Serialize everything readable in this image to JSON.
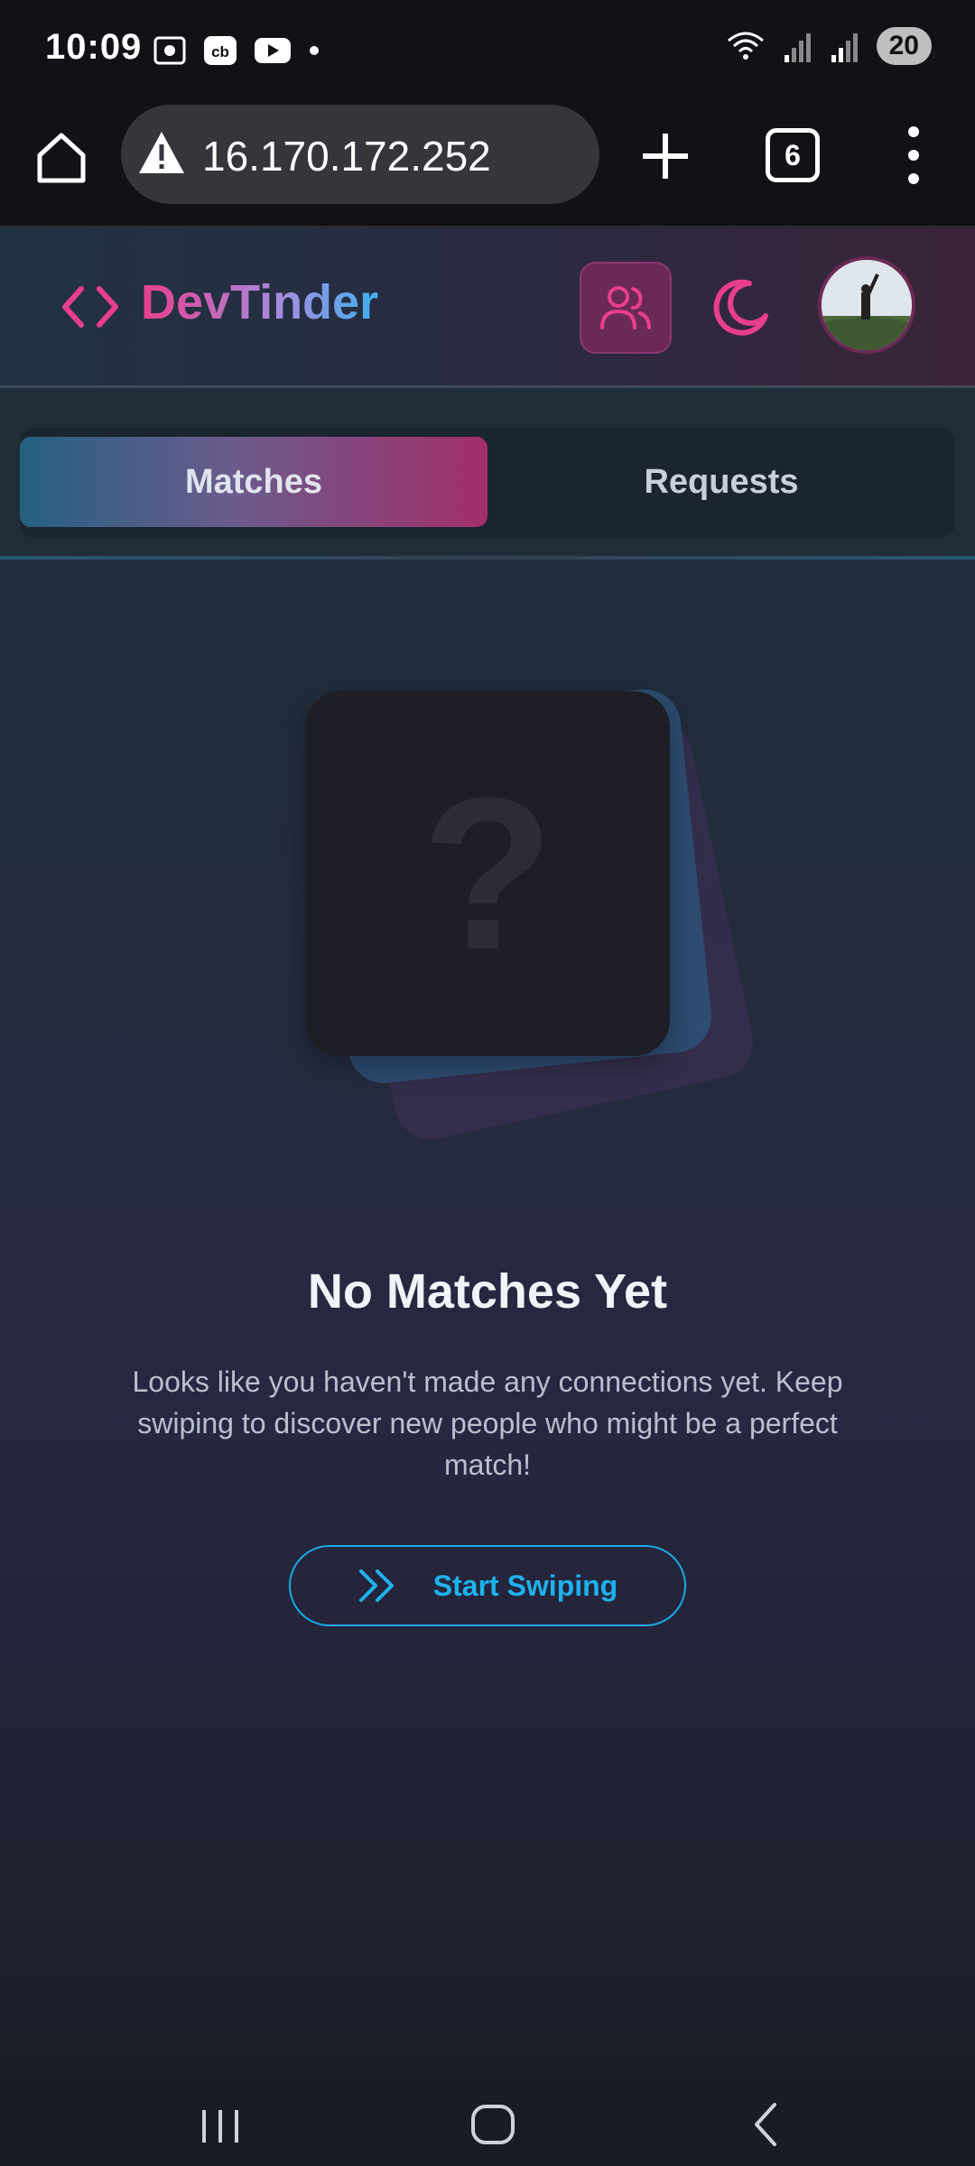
{
  "status_bar": {
    "time": "10:09",
    "battery": "20",
    "left_icons": [
      "screenshot-icon",
      "cb-icon",
      "youtube-icon",
      "dot-icon"
    ],
    "right_icons": [
      "wifi-icon",
      "signal-icon",
      "signal-icon"
    ]
  },
  "browser": {
    "url": "16.170.172.252",
    "tab_count": "6"
  },
  "header": {
    "app_name": "DevTinder",
    "accent_pink": "#e83e8c",
    "accent_blue": "#3fb0ee"
  },
  "tabs": [
    {
      "label": "Matches",
      "active": true
    },
    {
      "label": "Requests",
      "active": false
    }
  ],
  "empty_state": {
    "placeholder_glyph": "?",
    "title": "No Matches Yet",
    "description": "Looks like you haven't made any connections yet. Keep swiping to discover new people who might be a perfect match!",
    "cta_label": "Start Swiping"
  }
}
